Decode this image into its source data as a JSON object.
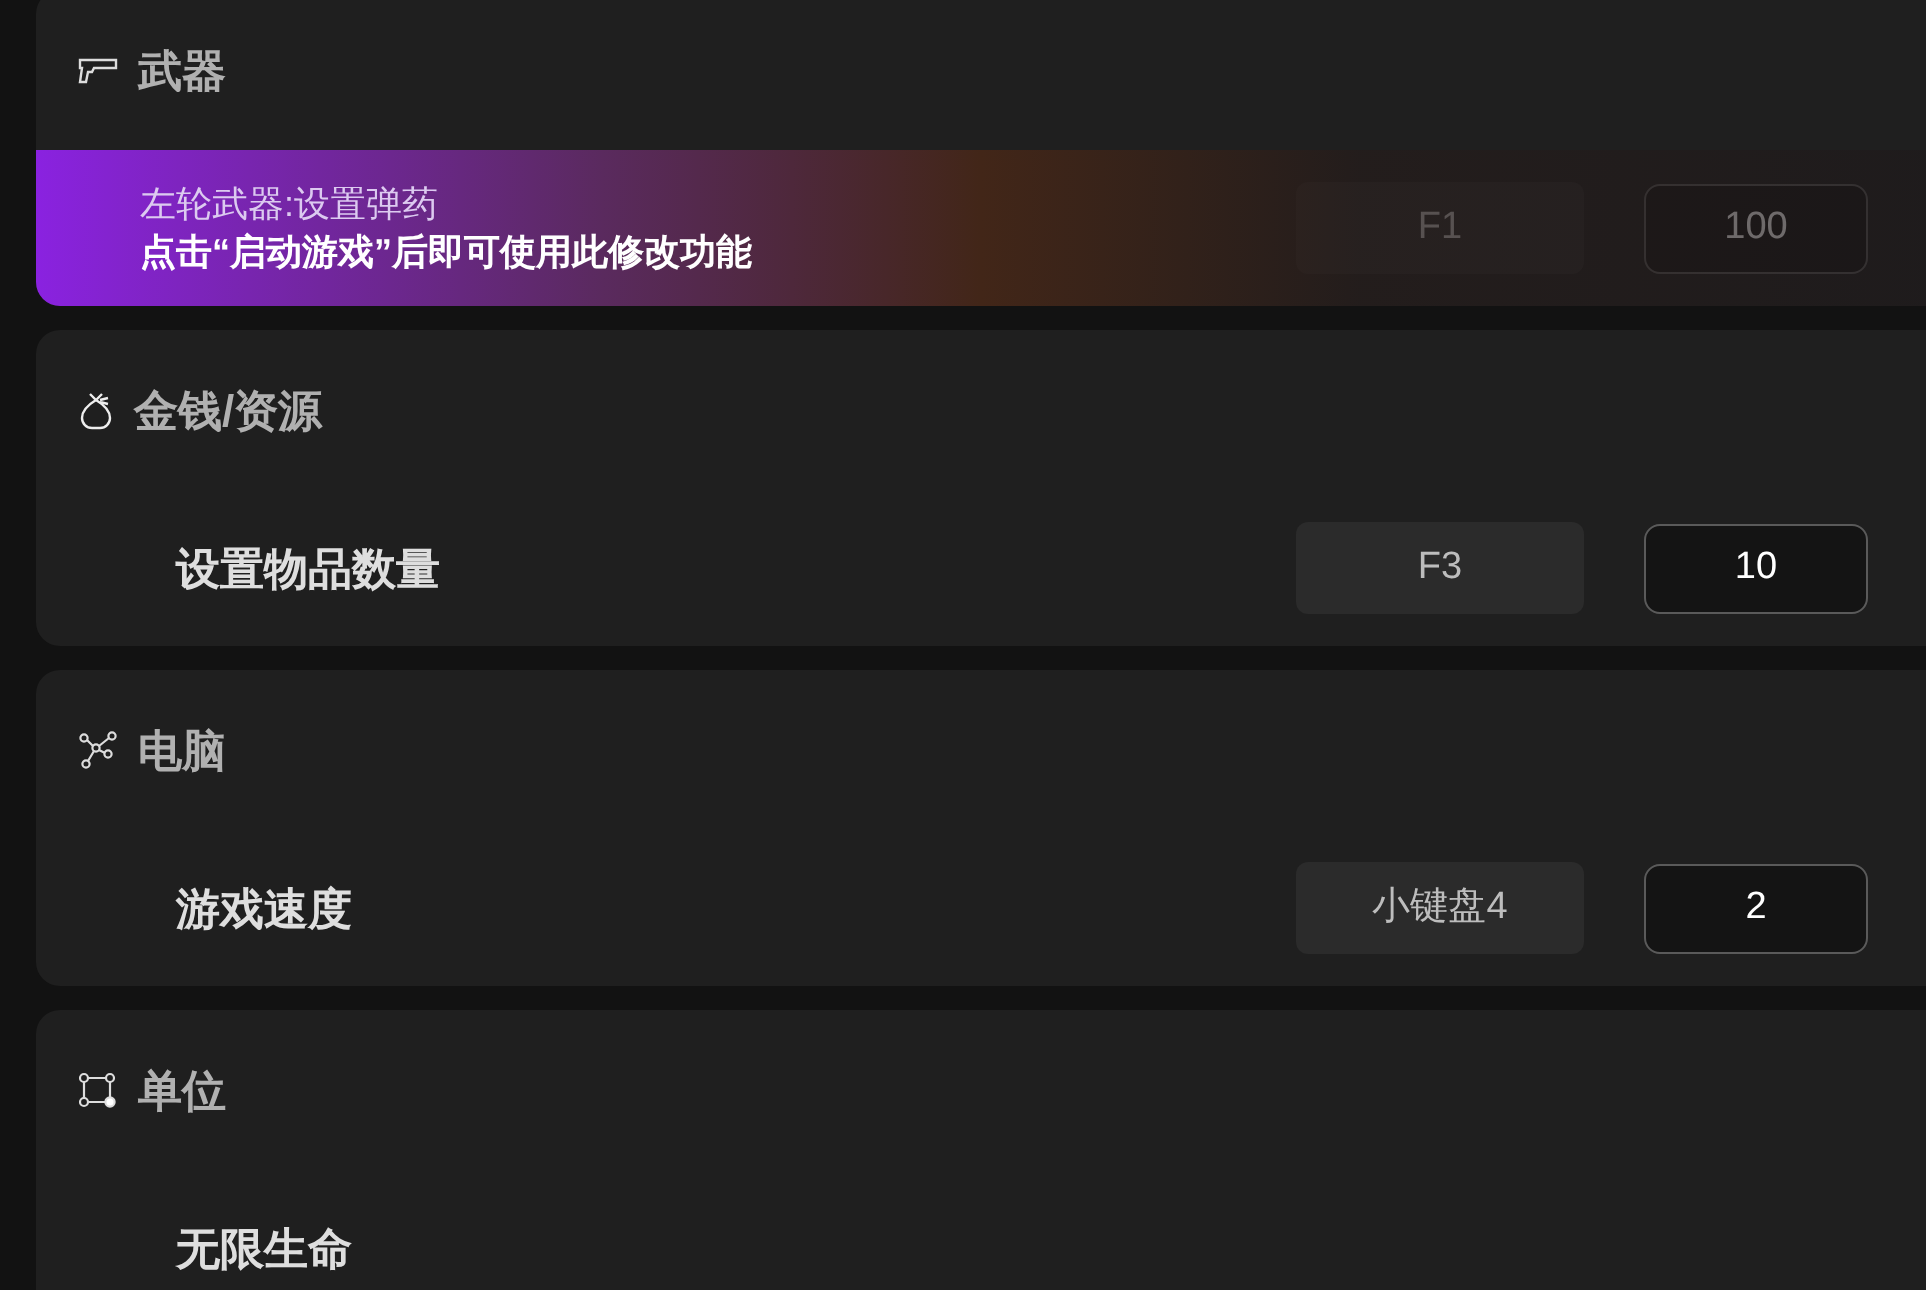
{
  "sections": [
    {
      "title": "武器",
      "kind": "pistol",
      "rows": [
        {
          "locked": true,
          "notice": {
            "title": "左轮武器:设置弹药",
            "message": "点击“启动游戏”后即可使用此修改功能"
          },
          "hotkey": "F1",
          "value": "100"
        }
      ]
    },
    {
      "title": "金钱/资源",
      "kind": "bag",
      "rows": [
        {
          "locked": false,
          "label": "设置物品数量",
          "hotkey": "F3",
          "value": "10"
        }
      ]
    },
    {
      "title": "电脑",
      "kind": "network",
      "rows": [
        {
          "locked": false,
          "label": "游戏速度",
          "hotkey": "小键盘4",
          "value": "2"
        }
      ]
    },
    {
      "title": "单位",
      "kind": "nodes",
      "rows": [
        {
          "locked": false,
          "label": "无限生命"
        }
      ]
    }
  ]
}
